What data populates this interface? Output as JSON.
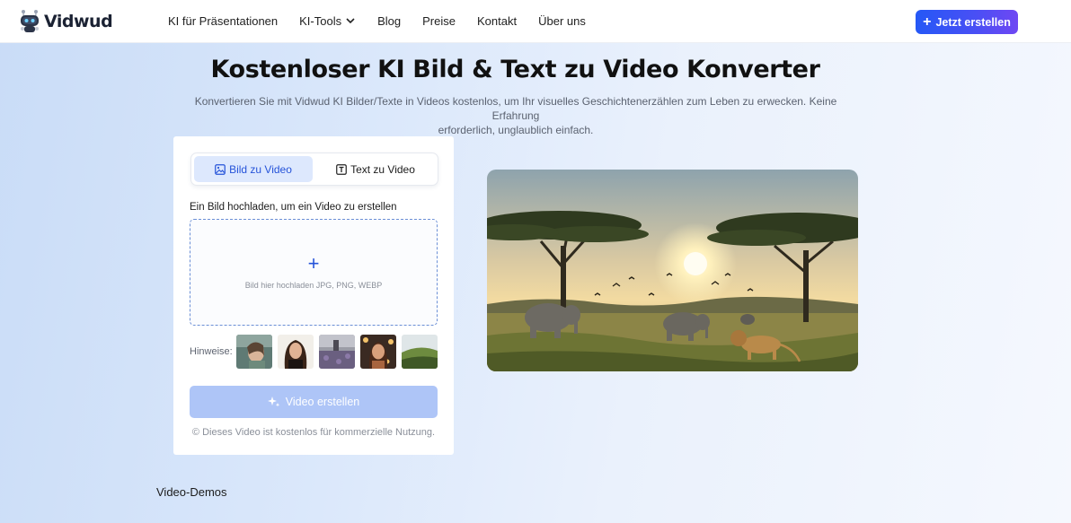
{
  "nav": {
    "brand": "Vidwud",
    "items": [
      {
        "label": "KI für Präsentationen"
      },
      {
        "label": "KI-Tools"
      },
      {
        "label": "Blog"
      },
      {
        "label": "Preise"
      },
      {
        "label": "Kontakt"
      },
      {
        "label": "Über uns"
      }
    ],
    "cta_label": "Jetzt erstellen"
  },
  "hero": {
    "title": "Kostenloser KI Bild & Text zu Video Konverter",
    "subtitle_line1": "Konvertieren Sie mit Vidwud KI Bilder/Texte in Videos kostenlos, um Ihr visuelles Geschichtenerzählen zum Leben zu erwecken. Keine Erfahrung",
    "subtitle_line2": "erforderlich, unglaublich einfach."
  },
  "card": {
    "tabs": [
      {
        "label": "Bild zu Video",
        "active": true
      },
      {
        "label": "Text zu Video",
        "active": false
      }
    ],
    "upload_label": "Ein Bild hochladen, um ein Video zu erstellen",
    "dropzone_plus": "+",
    "dropzone_hint": "Bild hier hochladen JPG, PNG, WEBP",
    "hints_label": "Hinweise:",
    "create_label": "Video erstellen",
    "note": "© Dieses Video ist kostenlos für kommerzielle Nutzung."
  },
  "section": {
    "demos_title": "Video-Demos"
  },
  "colors": {
    "accent": "#2558f6",
    "accent_purple": "#6f47f3",
    "tab_active_bg": "#dde8fd",
    "create_button_disabled": "#aec5f7"
  },
  "icons": [
    "robot-logo-icon",
    "chevron-down-icon",
    "plus-icon",
    "image-icon",
    "text-icon",
    "sparkle-icon"
  ]
}
